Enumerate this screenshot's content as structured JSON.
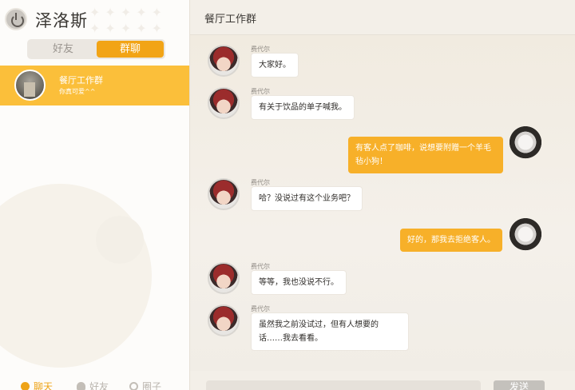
{
  "user": {
    "name": "泽洛斯"
  },
  "tabs": {
    "friends": "好友",
    "groups": "群聊"
  },
  "conversation": {
    "name": "餐厅工作群",
    "last_message": "你真可爱^^"
  },
  "bottom_nav": {
    "chat": "聊天",
    "friends": "好友",
    "circle": "圈子"
  },
  "chat": {
    "title": "餐厅工作群",
    "send_label": "发送",
    "input_placeholder": "",
    "messages": [
      {
        "side": "in",
        "sender": "费代尔",
        "text": "大家好。"
      },
      {
        "side": "in",
        "sender": "费代尔",
        "text": "有关于饮品的单子喊我。"
      },
      {
        "side": "out",
        "sender": "",
        "text": "有客人点了咖啡，说想要附赠一个羊毛毡小狗！"
      },
      {
        "side": "in",
        "sender": "费代尔",
        "text": "哈？没说过有这个业务吧？"
      },
      {
        "side": "out",
        "sender": "",
        "text": "好的，那我去拒绝客人。"
      },
      {
        "side": "in",
        "sender": "费代尔",
        "text": "等等，我也没说不行。"
      },
      {
        "side": "in",
        "sender": "费代尔",
        "text": "虽然我之前没试过，但有人想要的话……我去看看。"
      }
    ]
  },
  "colors": {
    "accent": "#f7b029",
    "accent_dark": "#f2a416",
    "conversation_bg": "#fbbf3a"
  },
  "icons": {
    "power": "power-icon",
    "chat": "chat-icon",
    "friends": "person-icon",
    "circle": "circle-icon"
  }
}
